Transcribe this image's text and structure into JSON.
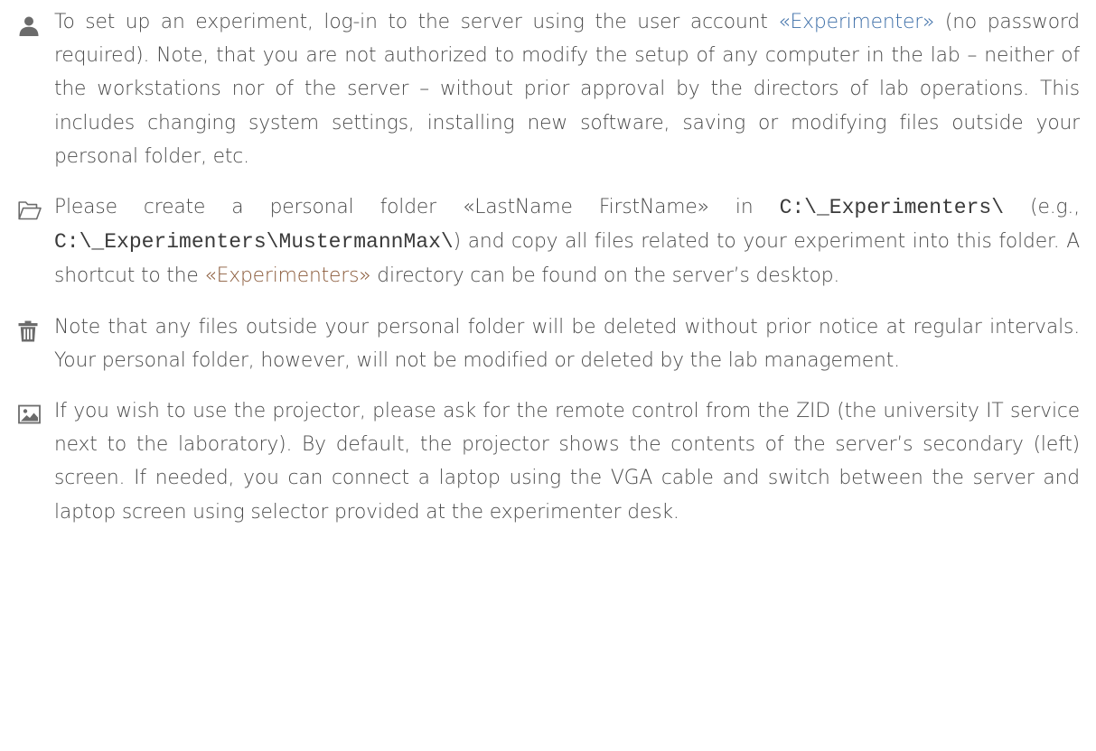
{
  "items": [
    {
      "icon": "user-icon",
      "parts": {
        "p1": "To set up an experiment, log-in to the server using the user account ",
        "link": "«Experimen­ter»",
        "p2": " (no password required). Note, that you are not authorized to modify the setup of any computer in the lab – neither of the workstations nor of the server – without prior approval by the directors of lab operations. This includes changing system settings, installing new software, saving or modifying files outside your personal folder, etc."
      }
    },
    {
      "icon": "folder-open-icon",
      "parts": {
        "p1": "Please create a personal folder «LastName FirstName» in ",
        "code1": "C:\\_Experimenters\\",
        "p2": " (e.g., ",
        "code2": "C:\\_Experimenters\\MustermannMax\\",
        "p3": ") and copy all files related to your experiment into this folder. A shortcut to the ",
        "link": "«Experimenters»",
        "p4": " directory can be found on the server’s desktop."
      }
    },
    {
      "icon": "trash-icon",
      "parts": {
        "p1": "Note that any files outside your personal folder will be deleted without prior notice at regular intervals. Your personal folder, however, will not be modified or deleted by the lab management."
      }
    },
    {
      "icon": "image-icon",
      "parts": {
        "p1": "If you wish to use the projector, please ask for the remote control from the ZID (the university IT service next to the laboratory). By default, the projector shows the contents of the server’s secondary (left) screen. If needed, you can connect a laptop using the VGA cable and switch between the server and laptop screen using selector provided at the experimenter desk."
      }
    }
  ],
  "colors": {
    "text": "#4a4a4a",
    "icon": "#6b6b6b",
    "link_blue": "#3e6fa8",
    "link_brown": "#8a5a3a"
  }
}
